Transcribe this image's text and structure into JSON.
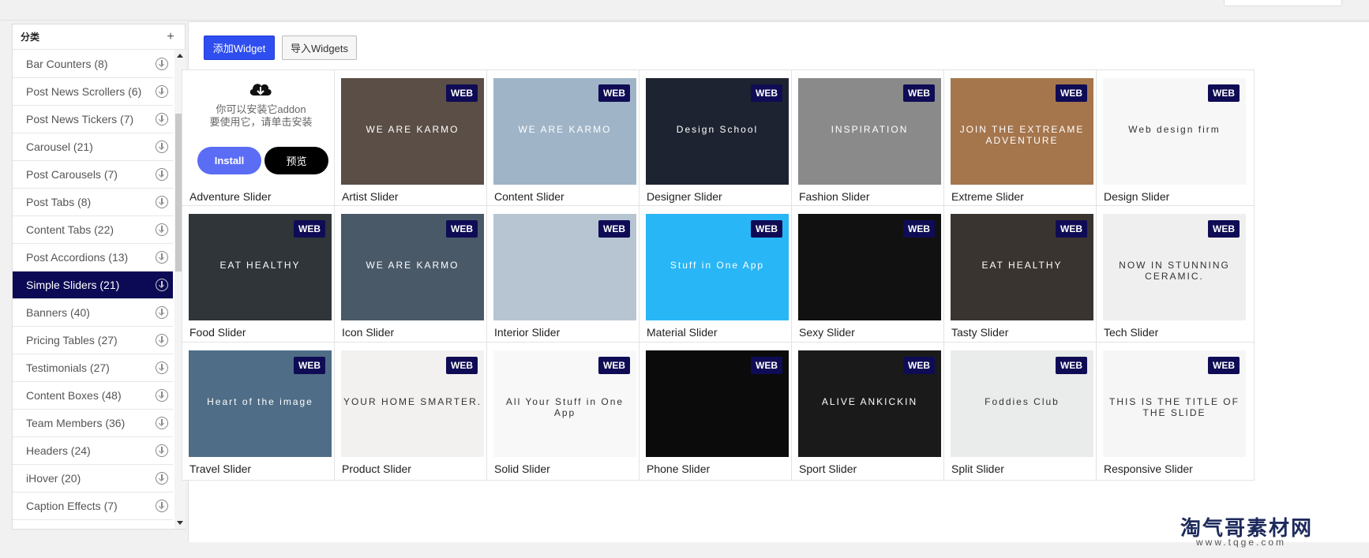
{
  "sidebar": {
    "title": "分类",
    "add_icon": "plus-icon",
    "items": [
      {
        "label": "Bar Counters (8)",
        "active": false
      },
      {
        "label": "Post News Scrollers (6)",
        "active": false
      },
      {
        "label": "Post News Tickers (7)",
        "active": false
      },
      {
        "label": "Carousel (21)",
        "active": false
      },
      {
        "label": "Post Carousels (7)",
        "active": false
      },
      {
        "label": "Post Tabs (8)",
        "active": false
      },
      {
        "label": "Content Tabs (22)",
        "active": false
      },
      {
        "label": "Post Accordions (13)",
        "active": false
      },
      {
        "label": "Simple Sliders (21)",
        "active": true
      },
      {
        "label": "Banners (40)",
        "active": false
      },
      {
        "label": "Pricing Tables (27)",
        "active": false
      },
      {
        "label": "Testimonials (27)",
        "active": false
      },
      {
        "label": "Content Boxes (48)",
        "active": false
      },
      {
        "label": "Team Members (36)",
        "active": false
      },
      {
        "label": "Headers (24)",
        "active": false
      },
      {
        "label": "iHover (20)",
        "active": false
      },
      {
        "label": "Caption Effects (7)",
        "active": false
      }
    ]
  },
  "toolbar": {
    "add_label": "添加Widget",
    "import_label": "导入Widgets"
  },
  "install_card": {
    "line1": "你可以安装它addon",
    "line2": "要使用它，请单击安装",
    "install_label": "Install",
    "preview_label": "预览",
    "name": "Adventure Slider"
  },
  "badge_text": "WEB",
  "widgets": [
    {
      "name": "Artist Slider",
      "thumb_text": "WE ARE KARMO",
      "bg": "#5a4e46"
    },
    {
      "name": "Content Slider",
      "thumb_text": "WE ARE KARMO",
      "bg": "#9fb4c7"
    },
    {
      "name": "Designer Slider",
      "thumb_text": "Design School",
      "bg": "#1d2330"
    },
    {
      "name": "Fashion Slider",
      "thumb_text": "INSPIRATION",
      "bg": "#8a8a8a"
    },
    {
      "name": "Extreme Slider",
      "thumb_text": "JOIN THE EXTREAME ADVENTURE",
      "bg": "#a5754c"
    },
    {
      "name": "Design Slider",
      "thumb_text": "Web design firm",
      "bg": "#f7f7f7"
    },
    {
      "name": "Food Slider",
      "thumb_text": "EAT HEALTHY",
      "bg": "#2f3539"
    },
    {
      "name": "Icon Slider",
      "thumb_text": "WE ARE KARMO",
      "bg": "#4a5968"
    },
    {
      "name": "Interior Slider",
      "thumb_text": "",
      "bg": "#b7c5d2"
    },
    {
      "name": "Material Slider",
      "thumb_text": "Stuff in One App",
      "bg": "#29b6f6"
    },
    {
      "name": "Sexy Slider",
      "thumb_text": "",
      "bg": "#111111"
    },
    {
      "name": "Tasty Slider",
      "thumb_text": "EAT HEALTHY",
      "bg": "#3a3430"
    },
    {
      "name": "Tech Slider",
      "thumb_text": "NOW IN STUNNING CERAMIC.",
      "bg": "#efefef"
    },
    {
      "name": "Travel Slider",
      "thumb_text": "Heart of the image",
      "bg": "#4f6d86"
    },
    {
      "name": "Product Slider",
      "thumb_text": "YOUR HOME SMARTER.",
      "bg": "#f3f1ef"
    },
    {
      "name": "Solid Slider",
      "thumb_text": "All Your Stuff in One App",
      "bg": "#f8f8f8"
    },
    {
      "name": "Phone Slider",
      "thumb_text": "",
      "bg": "#0b0b0b"
    },
    {
      "name": "Sport Slider",
      "thumb_text": "ALIVE ANKICKIN",
      "bg": "#1a1a1a"
    },
    {
      "name": "Split Slider",
      "thumb_text": "Foddies Club",
      "bg": "#e9ecea"
    },
    {
      "name": "Responsive Slider",
      "thumb_text": "THIS IS THE TITLE OF THE SLIDE",
      "bg": "#f6f6f6"
    }
  ],
  "watermark": {
    "title": "淘气哥素材网",
    "url": "www.tqge.com"
  }
}
